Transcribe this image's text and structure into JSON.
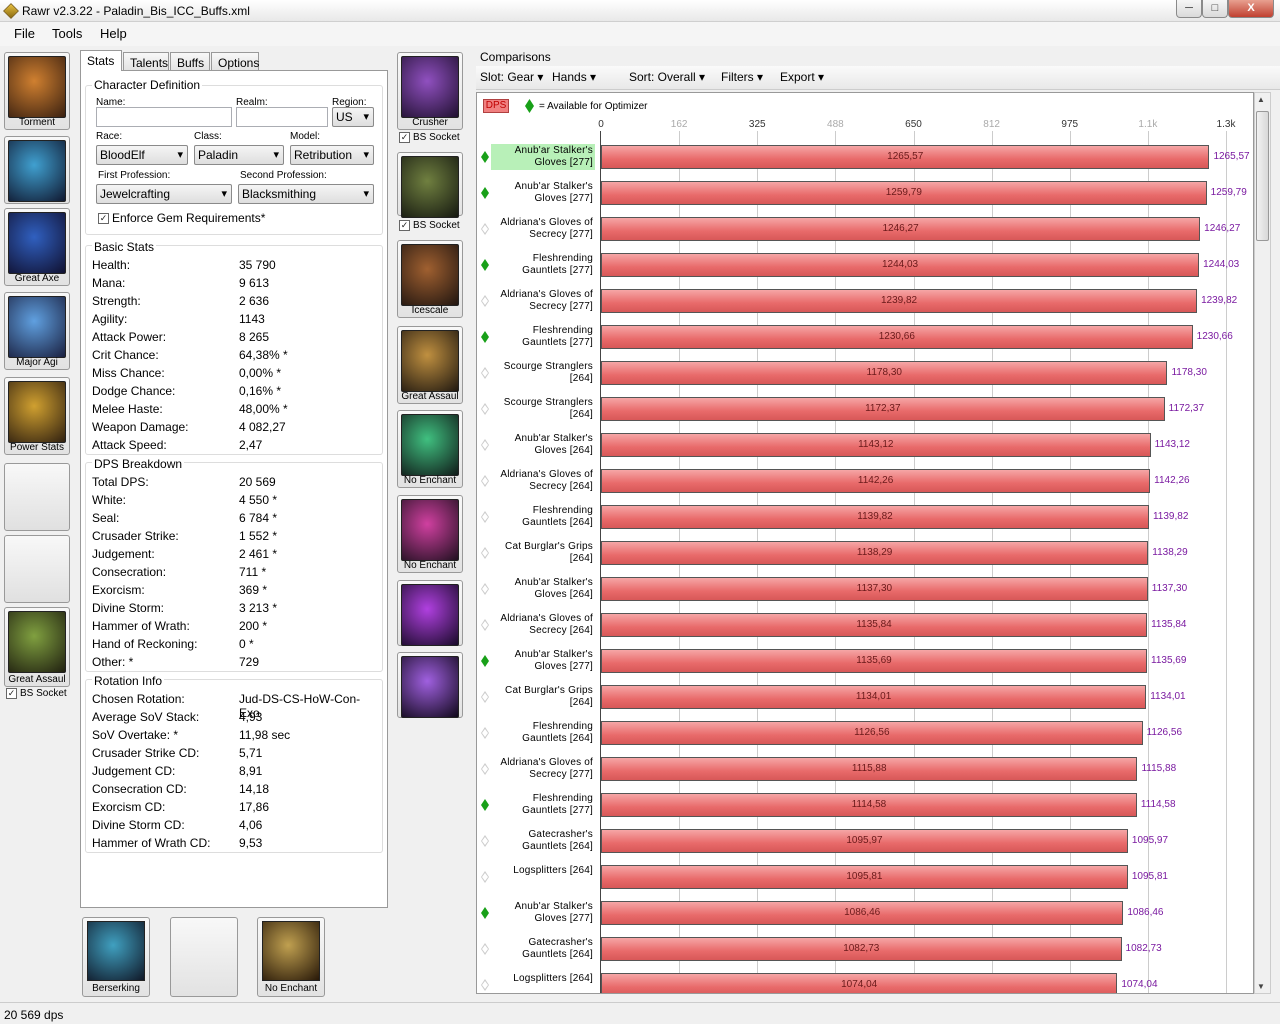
{
  "window": {
    "title": "Rawr v2.3.22 - Paladin_Bis_ICC_Buffs.xml",
    "min_label": "─",
    "max_label": "□",
    "close_label": "X"
  },
  "menu": [
    "File",
    "Tools",
    "Help"
  ],
  "left_slots": [
    {
      "label": "Torment",
      "color_a": "#d08030",
      "color_b": "#3a2010"
    },
    {
      "label": "",
      "color_a": "#40a0d0",
      "color_b": "#101830"
    },
    {
      "label": "Great Axe",
      "color_a": "#3060c0",
      "color_b": "#101030"
    },
    {
      "label": "Major Agi",
      "color_a": "#60a0e0",
      "color_b": "#1a2040"
    },
    {
      "label": "Power Stats",
      "color_a": "#d0a030",
      "color_b": "#302010"
    },
    {
      "label": "",
      "empty": true
    },
    {
      "label": "",
      "empty": true
    },
    {
      "label": "Great Assaul",
      "color_a": "#80a040",
      "color_b": "#202010"
    }
  ],
  "left_bs_socket": "BS Socket",
  "mid_slots": [
    {
      "label": "Crusher",
      "color_a": "#9050c0",
      "color_b": "#201030"
    },
    {
      "label": "",
      "color_a": "#708040",
      "color_b": "#151810"
    },
    {
      "label": "Icescale",
      "color_a": "#a06030",
      "color_b": "#201510"
    },
    {
      "label": "Great Assaul",
      "color_a": "#c09040",
      "color_b": "#201810"
    },
    {
      "label": "No Enchant",
      "color_a": "#40c080",
      "color_b": "#101a18"
    },
    {
      "label": "No Enchant",
      "color_a": "#d040a0",
      "color_b": "#201020"
    },
    {
      "label": "",
      "color_a": "#b040e0",
      "color_b": "#180a28"
    },
    {
      "label": "",
      "color_a": "#a060e0",
      "color_b": "#10081a"
    }
  ],
  "mid_bs_socket_1": "BS Socket",
  "mid_bs_socket_2": "BS Socket",
  "tabs": [
    "Stats",
    "Talents",
    "Buffs",
    "Options"
  ],
  "char_def": {
    "title": "Character Definition",
    "name_label": "Name:",
    "realm_label": "Realm:",
    "region_label": "Region:",
    "region": "US",
    "race_label": "Race:",
    "race": "BloodElf",
    "class_label": "Class:",
    "class": "Paladin",
    "model_label": "Model:",
    "model": "Retribution",
    "prof1_label": "First Profession:",
    "prof1": "Jewelcrafting",
    "prof2_label": "Second Profession:",
    "prof2": "Blacksmithing",
    "enforce_label": "Enforce Gem Requirements*"
  },
  "basic_stats": {
    "title": "Basic Stats",
    "rows": [
      [
        "Health:",
        "35 790"
      ],
      [
        "Mana:",
        "9 613"
      ],
      [
        "Strength:",
        "2 636"
      ],
      [
        "Agility:",
        "1143"
      ],
      [
        "Attack Power:",
        "8 265"
      ],
      [
        "Crit Chance:",
        "64,38% *"
      ],
      [
        "Miss Chance:",
        "0,00% *"
      ],
      [
        "Dodge Chance:",
        "0,16% *"
      ],
      [
        "Melee Haste:",
        "48,00% *"
      ],
      [
        "Weapon Damage:",
        "4 082,27"
      ],
      [
        "Attack Speed:",
        "2,47"
      ]
    ]
  },
  "dps_breakdown": {
    "title": "DPS Breakdown",
    "rows": [
      [
        "Total DPS:",
        "20 569"
      ],
      [
        "White:",
        "4 550 *"
      ],
      [
        "Seal:",
        "6 784 *"
      ],
      [
        "Crusader Strike:",
        "1 552 *"
      ],
      [
        "Judgement:",
        "2 461 *"
      ],
      [
        "Consecration:",
        "711 *"
      ],
      [
        "Exorcism:",
        "369 *"
      ],
      [
        "Divine Storm:",
        "3 213 *"
      ],
      [
        "Hammer of Wrath:",
        "200 *"
      ],
      [
        "Hand of Reckoning:",
        "0 *"
      ],
      [
        "Other: *",
        "729"
      ]
    ]
  },
  "rotation_info": {
    "title": "Rotation Info",
    "rows": [
      [
        "Chosen Rotation:",
        "Jud-DS-CS-HoW-Con-Exo"
      ],
      [
        "Average SoV Stack:",
        "4,93"
      ],
      [
        "SoV Overtake: *",
        "11,98 sec"
      ],
      [
        "Crusader Strike CD:",
        "5,71"
      ],
      [
        "Judgement CD:",
        "8,91"
      ],
      [
        "Consecration CD:",
        "14,18"
      ],
      [
        "Exorcism CD:",
        "17,86"
      ],
      [
        "Divine Storm CD:",
        "4,06"
      ],
      [
        "Hammer of Wrath CD:",
        "9,53"
      ]
    ]
  },
  "bottom_slots": [
    {
      "label": "Berserking",
      "color_a": "#40a0c0",
      "color_b": "#101828"
    },
    {
      "label": "",
      "empty": true
    },
    {
      "label": "No Enchant",
      "color_a": "#c0a050",
      "color_b": "#281808"
    }
  ],
  "comparisons": {
    "title": "Comparisons",
    "toolbar": [
      "Slot: Gear",
      "Hands",
      "Sort: Overall",
      "Filters",
      "Export"
    ],
    "legend_label": "DPS",
    "legend_text": "= Available for Optimizer"
  },
  "chart_data": {
    "type": "bar",
    "orientation": "horizontal",
    "xlim": [
      0,
      1300
    ],
    "ticks": [
      {
        "value": 0,
        "label": "0",
        "faded": false
      },
      {
        "value": 162.5,
        "label": "162",
        "faded": true
      },
      {
        "value": 325,
        "label": "325",
        "faded": false
      },
      {
        "value": 487.5,
        "label": "488",
        "faded": true
      },
      {
        "value": 650,
        "label": "650",
        "faded": false
      },
      {
        "value": 812.5,
        "label": "812",
        "faded": true
      },
      {
        "value": 975,
        "label": "975",
        "faded": false
      },
      {
        "value": 1137.5,
        "label": "1.1k",
        "faded": true
      },
      {
        "value": 1300,
        "label": "1.3k",
        "faded": false
      }
    ],
    "items": [
      {
        "name": "Anub'ar Stalker's Gloves [277]",
        "value": 1265.57,
        "label": "1265,57",
        "gem": true,
        "highlight": true
      },
      {
        "name": "Anub'ar Stalker's Gloves [277]",
        "value": 1259.79,
        "label": "1259,79",
        "gem": true
      },
      {
        "name": "Aldriana's Gloves of Secrecy [277]",
        "value": 1246.27,
        "label": "1246,27",
        "gem": false
      },
      {
        "name": "Fleshrending Gauntlets [277]",
        "value": 1244.03,
        "label": "1244,03",
        "gem": true
      },
      {
        "name": "Aldriana's Gloves of Secrecy [277]",
        "value": 1239.82,
        "label": "1239,82",
        "gem": false
      },
      {
        "name": "Fleshrending Gauntlets [277]",
        "value": 1230.66,
        "label": "1230,66",
        "gem": true
      },
      {
        "name": "Scourge Stranglers [264]",
        "value": 1178.3,
        "label": "1178,30",
        "gem": false
      },
      {
        "name": "Scourge Stranglers [264]",
        "value": 1172.37,
        "label": "1172,37",
        "gem": false
      },
      {
        "name": "Anub'ar Stalker's Gloves [264]",
        "value": 1143.12,
        "label": "1143,12",
        "gem": false
      },
      {
        "name": "Aldriana's Gloves of Secrecy [264]",
        "value": 1142.26,
        "label": "1142,26",
        "gem": false
      },
      {
        "name": "Fleshrending Gauntlets [264]",
        "value": 1139.82,
        "label": "1139,82",
        "gem": false
      },
      {
        "name": "Cat Burglar's Grips [264]",
        "value": 1138.29,
        "label": "1138,29",
        "gem": false
      },
      {
        "name": "Anub'ar Stalker's Gloves [264]",
        "value": 1137.3,
        "label": "1137,30",
        "gem": false
      },
      {
        "name": "Aldriana's Gloves of Secrecy [264]",
        "value": 1135.84,
        "label": "1135,84",
        "gem": false
      },
      {
        "name": "Anub'ar Stalker's Gloves [277]",
        "value": 1135.69,
        "label": "1135,69",
        "gem": true
      },
      {
        "name": "Cat Burglar's Grips [264]",
        "value": 1134.01,
        "label": "1134,01",
        "gem": false
      },
      {
        "name": "Fleshrending Gauntlets [264]",
        "value": 1126.56,
        "label": "1126,56",
        "gem": false
      },
      {
        "name": "Aldriana's Gloves of Secrecy [277]",
        "value": 1115.88,
        "label": "1115,88",
        "gem": false
      },
      {
        "name": "Fleshrending Gauntlets [277]",
        "value": 1114.58,
        "label": "1114,58",
        "gem": true
      },
      {
        "name": "Gatecrasher's Gauntlets [264]",
        "value": 1095.97,
        "label": "1095,97",
        "gem": false
      },
      {
        "name": "Logsplitters [264]",
        "value": 1095.81,
        "label": "1095,81",
        "gem": false
      },
      {
        "name": "Anub'ar Stalker's Gloves [277]",
        "value": 1086.46,
        "label": "1086,46",
        "gem": true
      },
      {
        "name": "Gatecrasher's Gauntlets [264]",
        "value": 1082.73,
        "label": "1082,73",
        "gem": false
      },
      {
        "name": "Logsplitters [264]",
        "value": 1074.04,
        "label": "1074,04",
        "gem": false
      }
    ]
  },
  "status": "20 569 dps"
}
